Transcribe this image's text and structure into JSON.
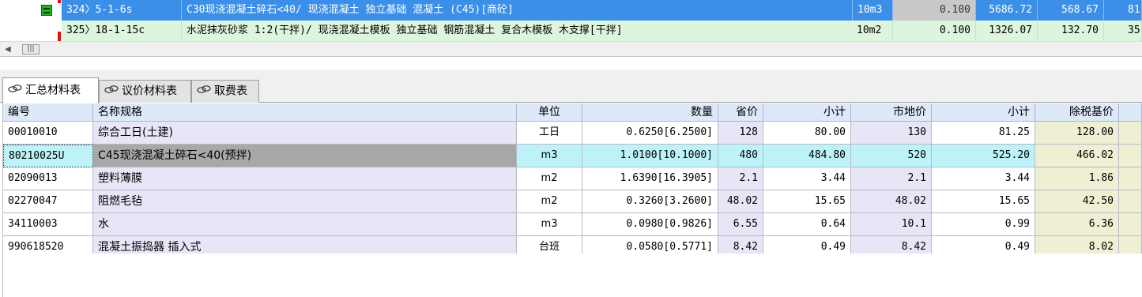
{
  "top_grid": {
    "rows": [
      {
        "seq_code": "324〉5-1-6s",
        "description": "C30现浇混凝土碎石<40/ 现浇混凝土 独立基础 混凝土    (C45)[商砼]",
        "unit": "10m3",
        "quantity": "0.100",
        "unit_price": "5686.72",
        "amount": "568.67",
        "extra": "81."
      },
      {
        "seq_code": "325〉18-1-15c",
        "description": "水泥抹灰砂浆 1:2(干拌)/ 现浇混凝土模板 独立基础 钢筋混凝土 复合木模板 木支撑[干拌]",
        "unit": "10m2",
        "quantity": "0.100",
        "unit_price": "1326.07",
        "amount": "132.70",
        "extra": "35"
      }
    ]
  },
  "scrollbar": {
    "left_arrow": "◀",
    "thumb": "|||"
  },
  "tabs": [
    {
      "label": "汇总材料表",
      "icon": "link-icon",
      "active": true
    },
    {
      "label": "议价材料表",
      "icon": "link-icon",
      "active": false
    },
    {
      "label": "取费表",
      "icon": "link-icon",
      "active": false
    }
  ],
  "material_table": {
    "headers": {
      "code": "编号",
      "name": "名称规格",
      "unit": "单位",
      "quantity": "数量",
      "province_price": "省价",
      "subtotal1": "小计",
      "market_price": "市地价",
      "subtotal2": "小计",
      "pretax_price": "除税基价"
    },
    "rows": [
      {
        "code": "00010010",
        "name": "综合工日(土建)",
        "unit": "工日",
        "quantity": "0.6250[6.2500]",
        "province_price": "128",
        "subtotal1": "80.00",
        "market_price": "130",
        "subtotal2": "81.25",
        "pretax_price": "128.00"
      },
      {
        "code": "80210025U",
        "name": "C45现浇混凝土碎石<40(预拌)",
        "unit": "m3",
        "quantity": "1.0100[10.1000]",
        "province_price": "480",
        "subtotal1": "484.80",
        "market_price": "520",
        "subtotal2": "525.20",
        "pretax_price": "466.02"
      },
      {
        "code": "02090013",
        "name": "塑料薄膜",
        "unit": "m2",
        "quantity": "1.6390[16.3905]",
        "province_price": "2.1",
        "subtotal1": "3.44",
        "market_price": "2.1",
        "subtotal2": "3.44",
        "pretax_price": "1.86"
      },
      {
        "code": "02270047",
        "name": "阻燃毛毡",
        "unit": "m2",
        "quantity": "0.3260[3.2600]",
        "province_price": "48.02",
        "subtotal1": "15.65",
        "market_price": "48.02",
        "subtotal2": "15.65",
        "pretax_price": "42.50"
      },
      {
        "code": "34110003",
        "name": "水",
        "unit": "m3",
        "quantity": "0.0980[0.9826]",
        "province_price": "6.55",
        "subtotal1": "0.64",
        "market_price": "10.1",
        "subtotal2": "0.99",
        "pretax_price": "6.36"
      },
      {
        "code": "990618520",
        "name": "混凝土振捣器 插入式",
        "unit": "台班",
        "quantity": "0.0580[0.5771]",
        "province_price": "8.42",
        "subtotal1": "0.49",
        "market_price": "8.42",
        "subtotal2": "0.49",
        "pretax_price": "8.02"
      }
    ],
    "selected_row": 1
  },
  "colors": {
    "selection_blue": "#3c8fe8",
    "next_row_green": "#ddf4dd",
    "selected_row_cyan": "#bdf3f8",
    "header_blue": "#dde8f8",
    "name_column_lavender": "#e6e6f6",
    "pretax_column_beige": "#efefd4",
    "flag_red": "#e01010"
  }
}
